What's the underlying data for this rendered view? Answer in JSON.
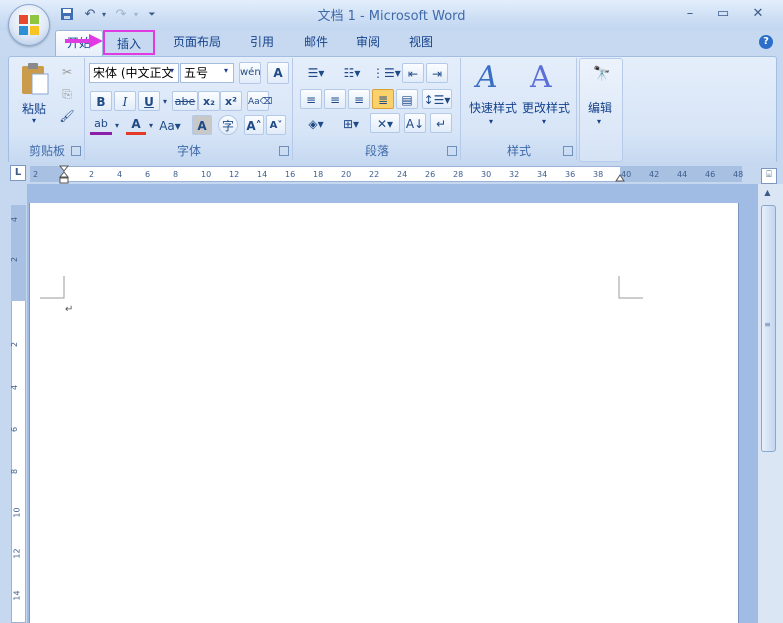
{
  "window": {
    "title": "文档 1 - Microsoft Word",
    "minimize_icon": "minimize-icon",
    "maximize_icon": "maximize-icon",
    "close_icon": "close-icon"
  },
  "quick_access": {
    "save_icon": "save-icon",
    "undo_icon": "undo-icon",
    "redo_icon": "redo-icon",
    "customize_icon": "customize-icon"
  },
  "tabs": [
    {
      "label": "开始"
    },
    {
      "label": "插入"
    },
    {
      "label": "页面布局"
    },
    {
      "label": "引用"
    },
    {
      "label": "邮件"
    },
    {
      "label": "审阅"
    },
    {
      "label": "视图"
    }
  ],
  "annotation": {
    "color": "#e03be3"
  },
  "ribbon": {
    "clipboard": {
      "label": "剪贴板",
      "paste_label": "粘贴"
    },
    "font": {
      "label": "字体",
      "font_name": "宋体 (中文正文",
      "font_size": "五号",
      "bold": "B",
      "italic": "I",
      "underline": "U",
      "strike": "abe",
      "subscript": "x₂",
      "superscript": "x²"
    },
    "paragraph": {
      "label": "段落"
    },
    "styles": {
      "label": "样式",
      "quick_styles": "快速样式",
      "change_styles": "更改样式"
    },
    "editing": {
      "label": "编辑"
    }
  },
  "ruler": {
    "ticks": [
      "2",
      "2",
      "4",
      "6",
      "8",
      "10",
      "12",
      "14",
      "16",
      "18",
      "20",
      "22",
      "24",
      "26",
      "28",
      "30",
      "32",
      "34",
      "36",
      "38",
      "40",
      "42",
      "44",
      "46",
      "48"
    ]
  },
  "vruler": {
    "ticks": [
      "4",
      "2",
      "2",
      "4",
      "6",
      "8",
      "10",
      "12",
      "14"
    ]
  },
  "document": {
    "paragraph_mark": "↵"
  }
}
